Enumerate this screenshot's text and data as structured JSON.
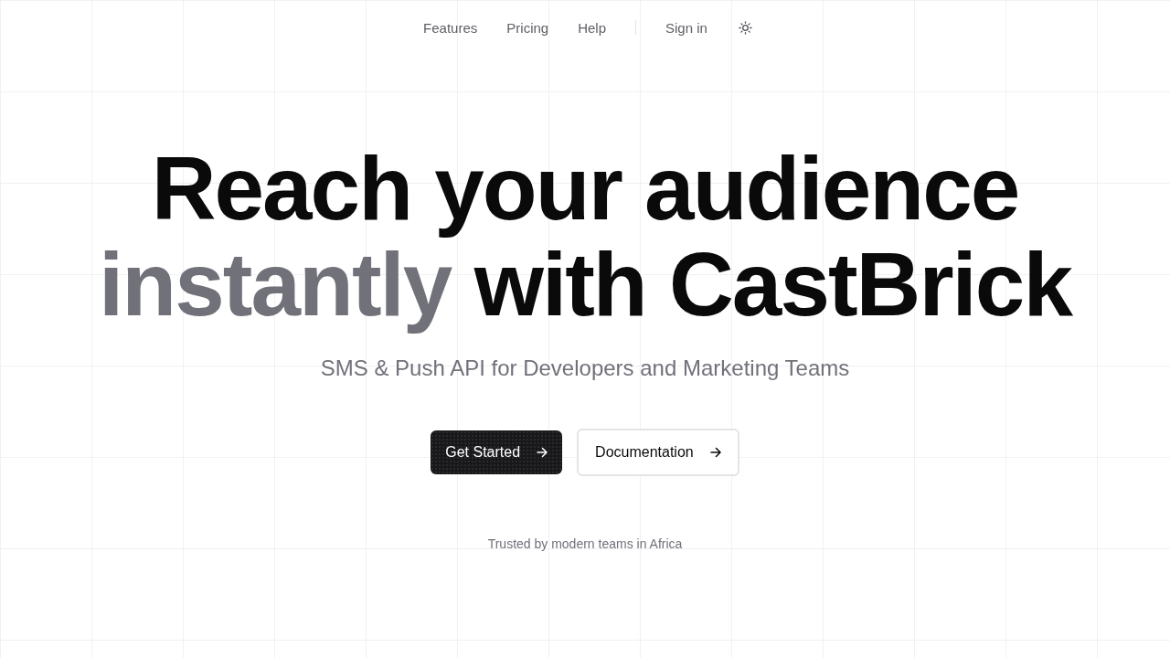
{
  "nav": {
    "links": [
      {
        "label": "Features"
      },
      {
        "label": "Pricing"
      },
      {
        "label": "Help"
      }
    ],
    "sign_in": "Sign in"
  },
  "hero": {
    "heading": [
      [
        {
          "text": "Reach your audience",
          "muted": false
        }
      ],
      [
        {
          "text": "instantly",
          "muted": true
        },
        {
          "text": "with CastBrick",
          "muted": false
        }
      ]
    ],
    "subtitle": "SMS & Push API for Developers and Marketing Teams",
    "buttons": [
      {
        "label": "Get Started",
        "kind": "primary"
      },
      {
        "label": "Documentation",
        "kind": "secondary"
      }
    ],
    "trust_line": "Trusted by modern teams in Africa"
  }
}
